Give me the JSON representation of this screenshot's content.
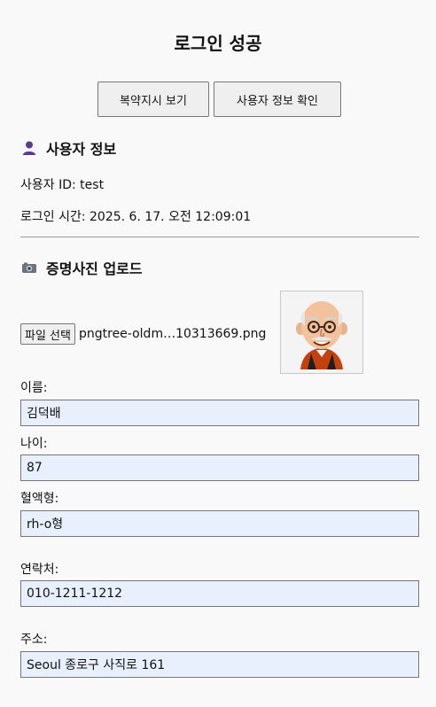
{
  "header": {
    "title": "로그인 성공"
  },
  "actions": {
    "prescription_label": "복약지시 보기",
    "userinfo_label": "사용자 정보 확인"
  },
  "user_section": {
    "heading": "사용자 정보",
    "icon": "user-icon",
    "id_line": "사용자 ID: test",
    "time_line": "로그인 시간: 2025. 6. 17. 오전 12:09:01"
  },
  "photo_section": {
    "heading": "증명사진 업로드",
    "icon": "camera-icon",
    "file_button_label": "파일 선택",
    "file_name": "pngtree-oldm…10313669.png"
  },
  "form": {
    "name_label": "이름:",
    "name_value": "김덕배",
    "age_label": "나이:",
    "age_value": "87",
    "blood_label": "혈액형:",
    "blood_value": "rh-o형",
    "contact_label": "연락처:",
    "contact_value": "010-1211-1212",
    "address_label": "주소:",
    "address_value": "Seoul 종로구 사직로 161"
  },
  "colors": {
    "input_autofill_bg": "#e8f0fe",
    "user_icon_color": "#5b3a8c"
  }
}
